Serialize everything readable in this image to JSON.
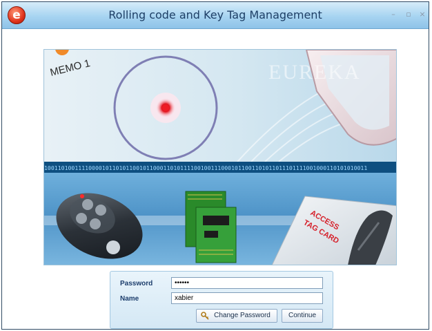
{
  "window": {
    "title": "Rolling code and Key Tag Management",
    "logo_letter": "e",
    "minimize_glyph": "–",
    "maximize_glyph": "▫",
    "close_glyph": "×"
  },
  "banner": {
    "memo_label": "MEMO 1",
    "brand_watermark": "EUREKA",
    "binary_text": "10011010011110000101101011001011000110101111001001110001011001101011011101111001000110101010011",
    "tag_card_text": [
      "ACCESS",
      "TAG CARD"
    ]
  },
  "login": {
    "password_label": "Password",
    "password_value": "••••••",
    "name_label": "Name",
    "name_value": "xabier",
    "change_password_label": "Change Password",
    "continue_label": "Continue"
  },
  "colors": {
    "title_text": "#1e3f66",
    "label_text": "#1c3d6c",
    "accent_red": "#e0341c"
  }
}
